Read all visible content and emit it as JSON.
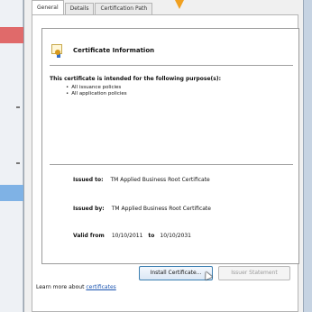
{
  "tabs": [
    {
      "label": "General"
    },
    {
      "label": "Details"
    },
    {
      "label": "Certification Path"
    }
  ],
  "cert": {
    "title": "Certificate Information",
    "purpose_heading": "This certificate is intended for the following purpose(s):",
    "purposes": [
      "All issuance policies",
      "All application policies"
    ],
    "issued_to_label": "Issued to:",
    "issued_to_value": "TM Applied Business Root Certificate",
    "issued_by_label": "Issued by:",
    "issued_by_value": "TM Applied Business Root Certificate",
    "valid_from_label": "Valid from",
    "valid_from_value": "10/10/2011",
    "valid_to_label": "to",
    "valid_to_value": "10/10/2031"
  },
  "buttons": {
    "install": "Install Certificate...",
    "issuer": "Issuer Statement"
  },
  "footer": {
    "learn_prefix": "Learn more about",
    "learn_link": "certificates"
  },
  "colors": {
    "link": "#1a53b0",
    "arrow": "#f0a020"
  }
}
